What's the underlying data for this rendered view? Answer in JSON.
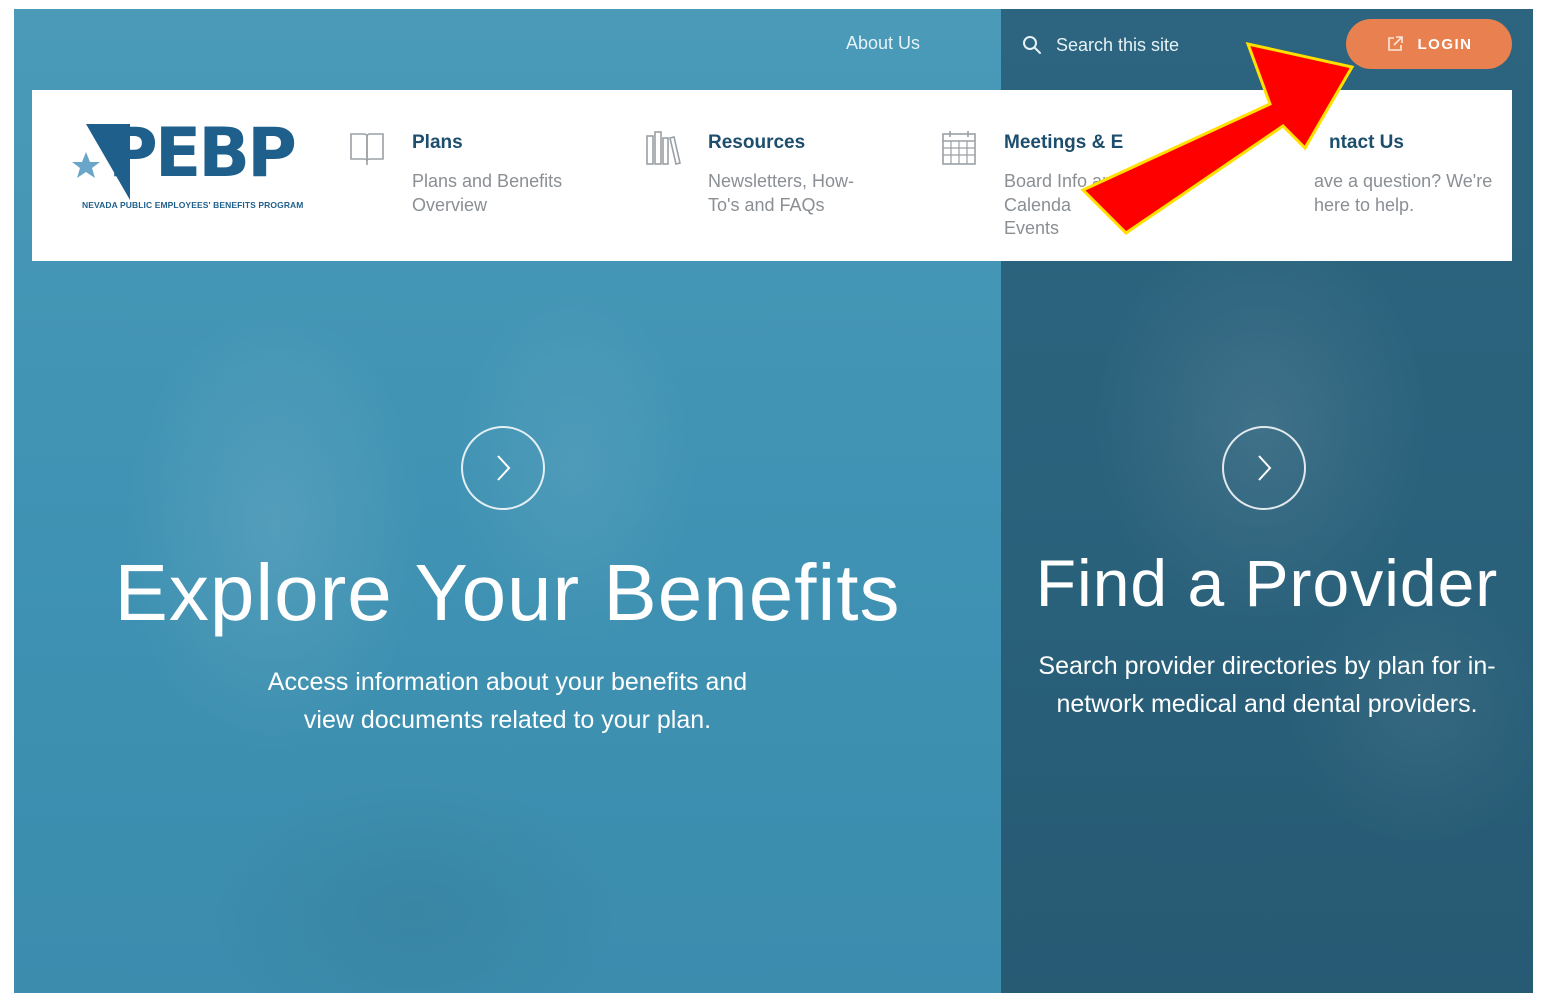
{
  "header": {
    "about_label": "About Us",
    "search_placeholder": "Search this site",
    "login_label": "LOGIN"
  },
  "logo": {
    "letters": "PEBP",
    "tagline": "NEVADA PUBLIC EMPLOYEES' BENEFITS PROGRAM"
  },
  "nav": {
    "items": [
      {
        "title": "Plans",
        "desc": "Plans and Benefits Overview",
        "icon": "book-icon"
      },
      {
        "title": "Resources",
        "desc": "Newsletters, How-To's and FAQs",
        "icon": "library-icon"
      },
      {
        "title": "Meetings & E",
        "desc": "Board Info and Calenda Events",
        "icon": "calendar-icon"
      },
      {
        "title": "ntact Us",
        "desc": "ave a question? We're here to help.",
        "icon": "contact-icon"
      }
    ]
  },
  "hero": {
    "left": {
      "title": "Explore Your Benefits",
      "subtitle_line1": "Access information about your benefits and",
      "subtitle_line2": "view documents related to your plan."
    },
    "right": {
      "title": "Find a Provider",
      "subtitle_line1": "Search provider directories by plan for in-",
      "subtitle_line2": "network medical and dental providers."
    }
  },
  "colors": {
    "login_bg": "#e8804f",
    "left_panel": "#4394b5",
    "right_panel": "#2b6280",
    "nav_title": "#1d4e6d",
    "annotation_arrow": "#ff0000",
    "annotation_outline": "#ffe000"
  }
}
